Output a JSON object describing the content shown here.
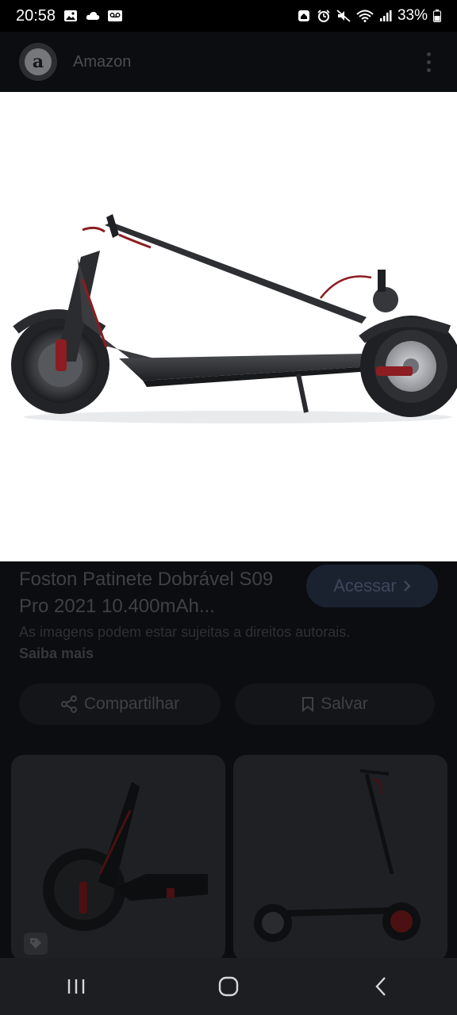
{
  "status_bar": {
    "time": "20:58",
    "battery": "33%",
    "icons": [
      "image-icon",
      "cloud-icon",
      "voicemail-icon",
      "house-icon",
      "alarm-icon",
      "mute-icon",
      "wifi-icon",
      "signal-icon",
      "battery-icon"
    ]
  },
  "app_bar": {
    "avatar_letter": "a",
    "title": "Amazon"
  },
  "hero": {
    "alt": "scooter-image"
  },
  "details": {
    "title": "Foston Patinete Dobrável S09 Pro 2021 10.400mAh...",
    "access_label": "Acessar",
    "rights_text": "As imagens podem estar sujeitas a direitos autorais.",
    "learn_more": "Saiba mais",
    "share_label": "Compartilhar",
    "save_label": "Salvar"
  },
  "colors": {
    "status_bar_bg": "#000000",
    "page_bg": "#0b0d10",
    "nav_bg": "#1c1e21",
    "accent_dim": "#1a2230"
  }
}
